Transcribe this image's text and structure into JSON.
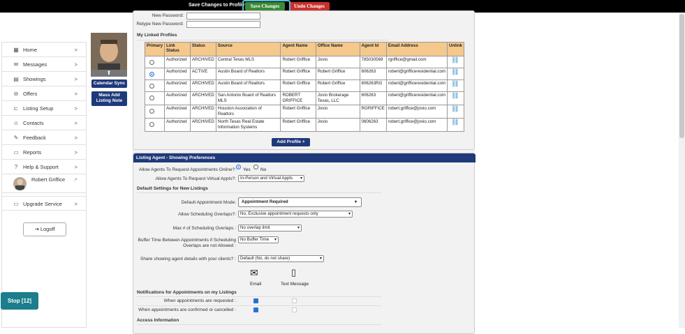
{
  "topbar": {
    "question": "Save Changes to Profile?",
    "save_label": "Save Changes",
    "undo_label": "Undo Changes"
  },
  "sidebar": {
    "items": [
      {
        "label": "Home",
        "icon": "home-icon",
        "glyph": "▦"
      },
      {
        "label": "Messages",
        "icon": "envelope-icon",
        "glyph": "✉"
      },
      {
        "label": "Showings",
        "icon": "calendar-icon",
        "glyph": "▤"
      },
      {
        "label": "Offers",
        "icon": "offers-icon",
        "glyph": "⊖"
      },
      {
        "label": "Listing Setup",
        "icon": "listing-icon",
        "glyph": "⊏"
      },
      {
        "label": "Contacts",
        "icon": "contacts-icon",
        "glyph": "☺"
      },
      {
        "label": "Feedback",
        "icon": "feedback-icon",
        "glyph": "✎"
      },
      {
        "label": "Reports",
        "icon": "reports-icon",
        "glyph": "▭"
      },
      {
        "label": "Help & Support",
        "icon": "help-icon",
        "glyph": "?"
      }
    ],
    "chevron": ">",
    "user_name": "Robert Griffice",
    "upgrade": "Upgrade Service",
    "logoff": "Logoff"
  },
  "profile": {
    "calendar_sync": "Calendar Sync",
    "mass_add": "Mass Add Listing Note"
  },
  "stop": "Stop [12]",
  "password": {
    "new_label": "New Password:",
    "retype_label": "Retype New Password:"
  },
  "linked": {
    "title": "My Linked Profiles",
    "headers": [
      "Primary",
      "Link Status",
      "Status",
      "Source",
      "Agent Name",
      "Office Name",
      "Agent Id",
      "Email Address",
      "Unlink"
    ],
    "rows": [
      [
        "Authorized",
        "ARCHIVED",
        "Central Texas MLS",
        "Robert Griffice",
        "Jovio",
        "785030569",
        "rgriffice@gmail.com"
      ],
      [
        "Authorized",
        "ACTIVE",
        "Austin Board of Realtors",
        "Robert Griffice",
        "Robert Griffice",
        "606263",
        "robert@grifficeresidential.com"
      ],
      [
        "Authorized",
        "ARCHIVED",
        "Austin Board of Realtors",
        "Robert Griffice",
        "Robert Griffice",
        "606263RG",
        "robert@grifficeresidential.com"
      ],
      [
        "Authorized",
        "ARCHIVED",
        "San Antonio Board of Realtors MLS",
        "ROBERT GRIFFICE",
        "Jovio Brokerage Texas, LLC",
        "606263",
        "robert@grifficeresidential.com"
      ],
      [
        "Authorized",
        "ARCHIVED",
        "Houston Association of Realtors",
        "Robert Griffice",
        "Jovio",
        "RGRIFFICE",
        "robert.griffice@jovio.com"
      ],
      [
        "Authorized",
        "ARCHIVED",
        "North Texas Real Estate Information Systems",
        "Robert Griffice",
        "Jovio",
        "0606263",
        "robert.griffice@jovio.com"
      ]
    ],
    "primary_index": 1,
    "add_profile": "Add Profile +"
  },
  "prefs": {
    "header": "Listing Agent - Showing Preferences",
    "allow_online_label": "Allow Agents To Request Appointments Online?:",
    "yes": "Yes",
    "no": "No",
    "allow_virtual_label": "Allow Agents To Request Virtual Appts?:",
    "allow_virtual_value": "In-Person and Virtual Appts",
    "defaults_title": "Default Settings for New Listings",
    "mode_label": "Default Appointment Mode:",
    "mode_value": "Appointment Required",
    "overlap_label": "Allow Scheduling Overlaps?:",
    "overlap_value": "No, Exclusive appointment requests only",
    "max_label": "Max # of Scheduling Overlaps :",
    "max_value": "No overlap limit",
    "buffer_label": "Buffer Time Between Appointments if Scheduling Overlaps are not Allowed :",
    "buffer_value": "No Buffer Time",
    "share_label": "Share showing agent details with your clients? :",
    "share_value": "Default (No, do not share)",
    "email": "Email",
    "text": "Text Message",
    "notif_title": "Notifications for Appointments on my Listings",
    "notif_requested": "When appointments are requested :",
    "notif_confirmed": "When appointments are confirmed or cancelled :",
    "access_title": "Access Information"
  }
}
